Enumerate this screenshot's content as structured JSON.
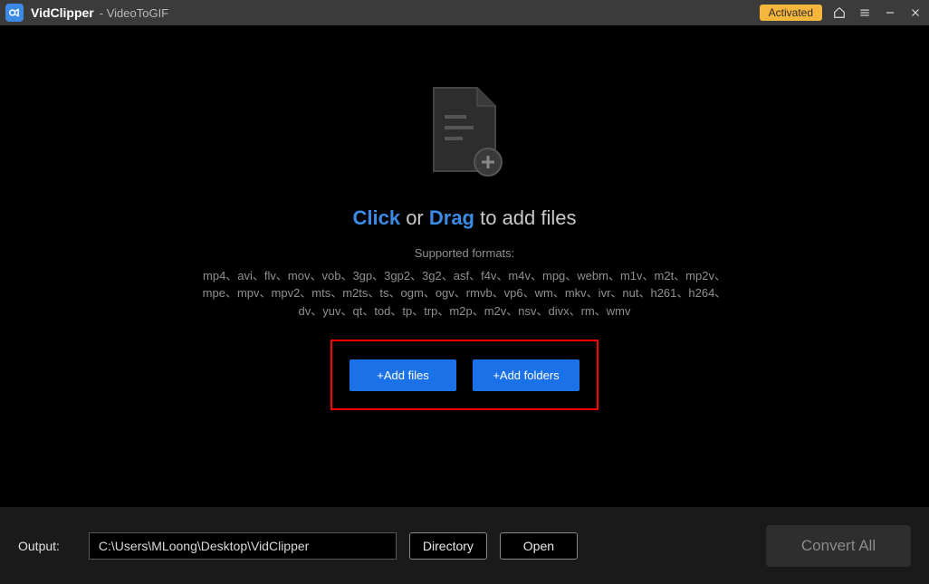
{
  "titlebar": {
    "app_name": "VidClipper",
    "subtitle": " - VideoToGIF",
    "activated_label": "Activated"
  },
  "main": {
    "headline_click": "Click",
    "headline_or": " or ",
    "headline_drag": "Drag",
    "headline_rest": " to add files",
    "supported_title": "Supported formats:",
    "formats": "mp4、avi、flv、mov、vob、3gp、3gp2、3g2、asf、f4v、m4v、mpg、webm、m1v、m2t、mp2v、mpe、mpv、mpv2、mts、m2ts、ts、ogm、ogv、rmvb、vp6、wm、mkv、ivr、nut、h261、h264、dv、yuv、qt、tod、tp、trp、m2p、m2v、nsv、divx、rm、wmv",
    "add_files_label": "+Add files",
    "add_folders_label": "+Add folders"
  },
  "bottom": {
    "output_label": "Output:",
    "path_value": "C:\\Users\\MLoong\\Desktop\\VidClipper",
    "directory_label": "Directory",
    "open_label": "Open",
    "convert_label": "Convert All"
  }
}
